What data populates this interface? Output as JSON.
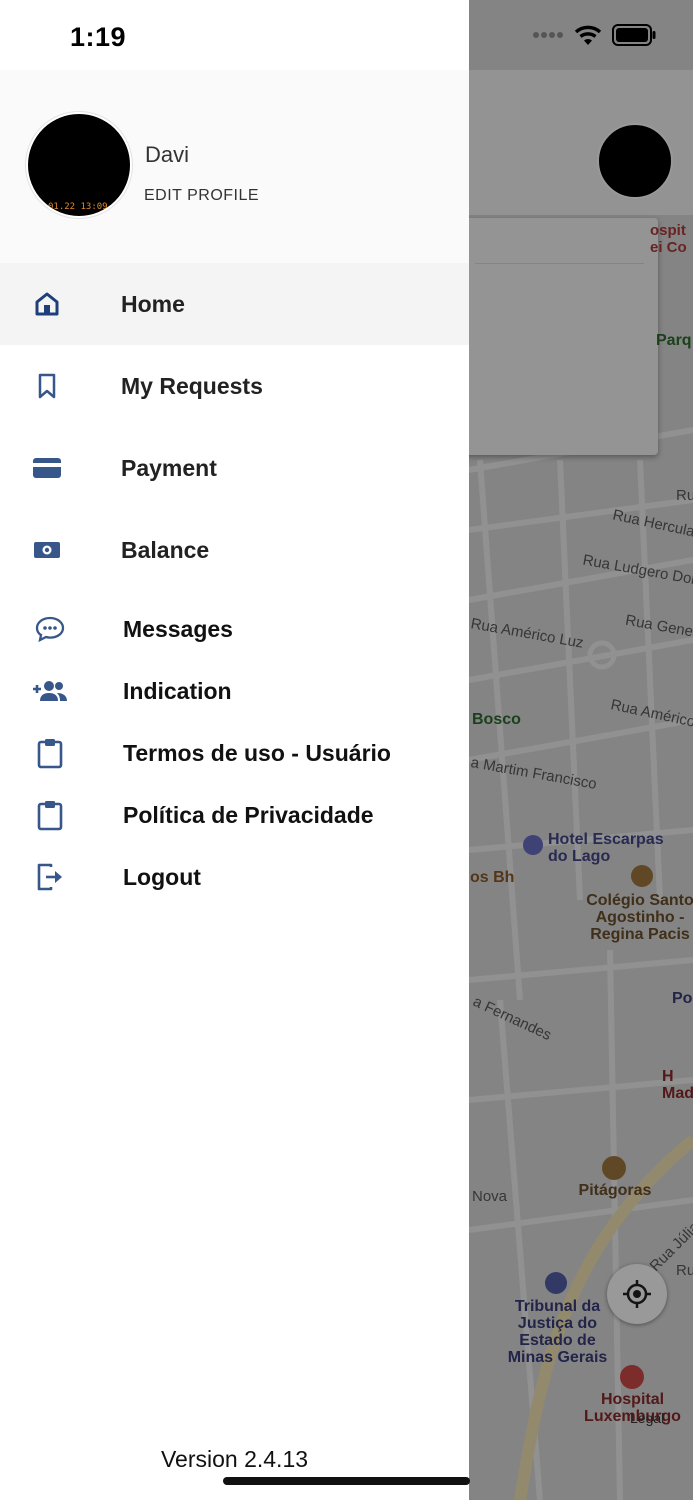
{
  "status_bar": {
    "time": "1:19"
  },
  "drawer": {
    "profile": {
      "name": "Davi",
      "edit_label": "EDIT PROFILE",
      "avatar_stamp": "01.22 13:09"
    },
    "menu": {
      "home": "Home",
      "my_requests": "My Requests",
      "payment": "Payment",
      "balance": "Balance",
      "messages": "Messages",
      "indication": "Indication",
      "terms": "Termos de uso - Usuário",
      "privacy": "Política de Privacidade",
      "logout": "Logout"
    },
    "version": "Version 2.4.13",
    "icon_color": "#37568a"
  },
  "map": {
    "streets": {
      "hercula": "Rua Hercula",
      "ludgero": "Rua Ludgero Dola",
      "americo_luz": "Rua Américo Luz",
      "gener": "Rua Gener",
      "americo": "Rua Américo",
      "martim": "a Martim Francisco",
      "fernandes": "a Fernandes",
      "nova": "Nova",
      "julia": "Rua Júlia Nu",
      "ru1": "Ru",
      "ru2": "Ru"
    },
    "places": {
      "hospital_top": "ospit ei Co",
      "parq": "Parq",
      "bosco": "Bosco",
      "hotel": "Hotel Escarpas do Lago",
      "os_bh": "os Bh",
      "colegio": "Colégio Santo Agostinho - Regina Pacis",
      "po": "Po",
      "mad": "H Mad",
      "pitagoras": "Pitágoras",
      "tribunal": "Tribunal da Justiça do Estado de Minas Gerais",
      "hospital_lux": "Hospital Luxemburgo",
      "legal": "Legal"
    }
  }
}
